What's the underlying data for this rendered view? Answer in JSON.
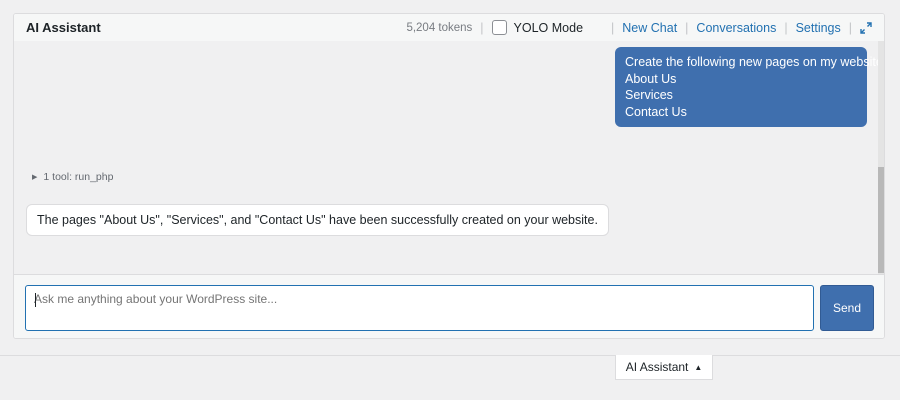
{
  "header": {
    "title": "AI Assistant",
    "tokens": "5,204 tokens",
    "yolo_label": "YOLO Mode",
    "yolo_checked": false,
    "new_chat": "New Chat",
    "conversations": "Conversations",
    "settings": "Settings",
    "expand_icon": "expand-icon"
  },
  "messages": {
    "user": {
      "lines": [
        "Create the following new pages on my website:",
        "About Us",
        "Services",
        "Contact Us"
      ]
    },
    "tool_summary": "1 tool: run_php",
    "assistant": "The pages \"About Us\", \"Services\", and \"Contact Us\" have been successfully created on your website."
  },
  "composer": {
    "placeholder": "Ask me anything about your WordPress site...",
    "send_label": "Send"
  },
  "bottom_tab": {
    "label": "AI Assistant",
    "icon": "triangle-up-icon"
  },
  "colors": {
    "accent": "#3f6fae",
    "link": "#2271b1",
    "background": "#f0f0f1"
  }
}
